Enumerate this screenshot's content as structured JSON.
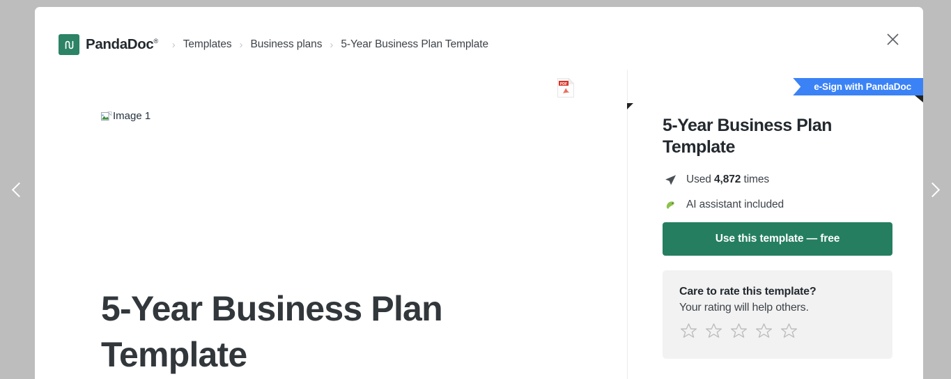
{
  "backdrop": {
    "prev_label": "Previous template",
    "next_label": "Next template",
    "prev_icon": "chevron-left-icon",
    "next_icon": "chevron-right-icon"
  },
  "modal": {
    "close_label": "Close",
    "close_icon": "close-icon"
  },
  "breadcrumb": {
    "logo": {
      "mark_text": "pd",
      "wordmark": "PandaDoc",
      "registered": "®",
      "icon": "pandadoc-logo-icon",
      "color": "#2c8366"
    },
    "separator": "›",
    "items": [
      {
        "label": "Templates",
        "current": false
      },
      {
        "label": "Business plans",
        "current": false
      },
      {
        "label": "5-Year Business Plan Template",
        "current": true
      }
    ]
  },
  "preview": {
    "pdf_icon": "pdf-file-icon",
    "pdf_label": "PDF",
    "image_placeholder": {
      "alt": "Image 1",
      "icon": "broken-image-icon"
    },
    "document_title": "5-Year Business Plan Template"
  },
  "rail": {
    "ribbon": {
      "label": "e-Sign with PandaDoc",
      "color": "#3b82f6"
    },
    "title": "5-Year Business Plan Template",
    "features": [
      {
        "icon": "send-plane-icon",
        "prefix": "Used ",
        "value": "4,872",
        "suffix": " times"
      },
      {
        "icon": "ai-assistant-icon",
        "prefix": "",
        "value": "",
        "suffix": "AI assistant included"
      }
    ],
    "cta": {
      "label": "Use this template — free",
      "color": "#257e60"
    },
    "rating": {
      "title": "Care to rate this template?",
      "subtitle": "Your rating will help others.",
      "icon": "star-outline-icon",
      "stars": [
        1,
        2,
        3,
        4,
        5
      ],
      "selected": 0
    }
  }
}
